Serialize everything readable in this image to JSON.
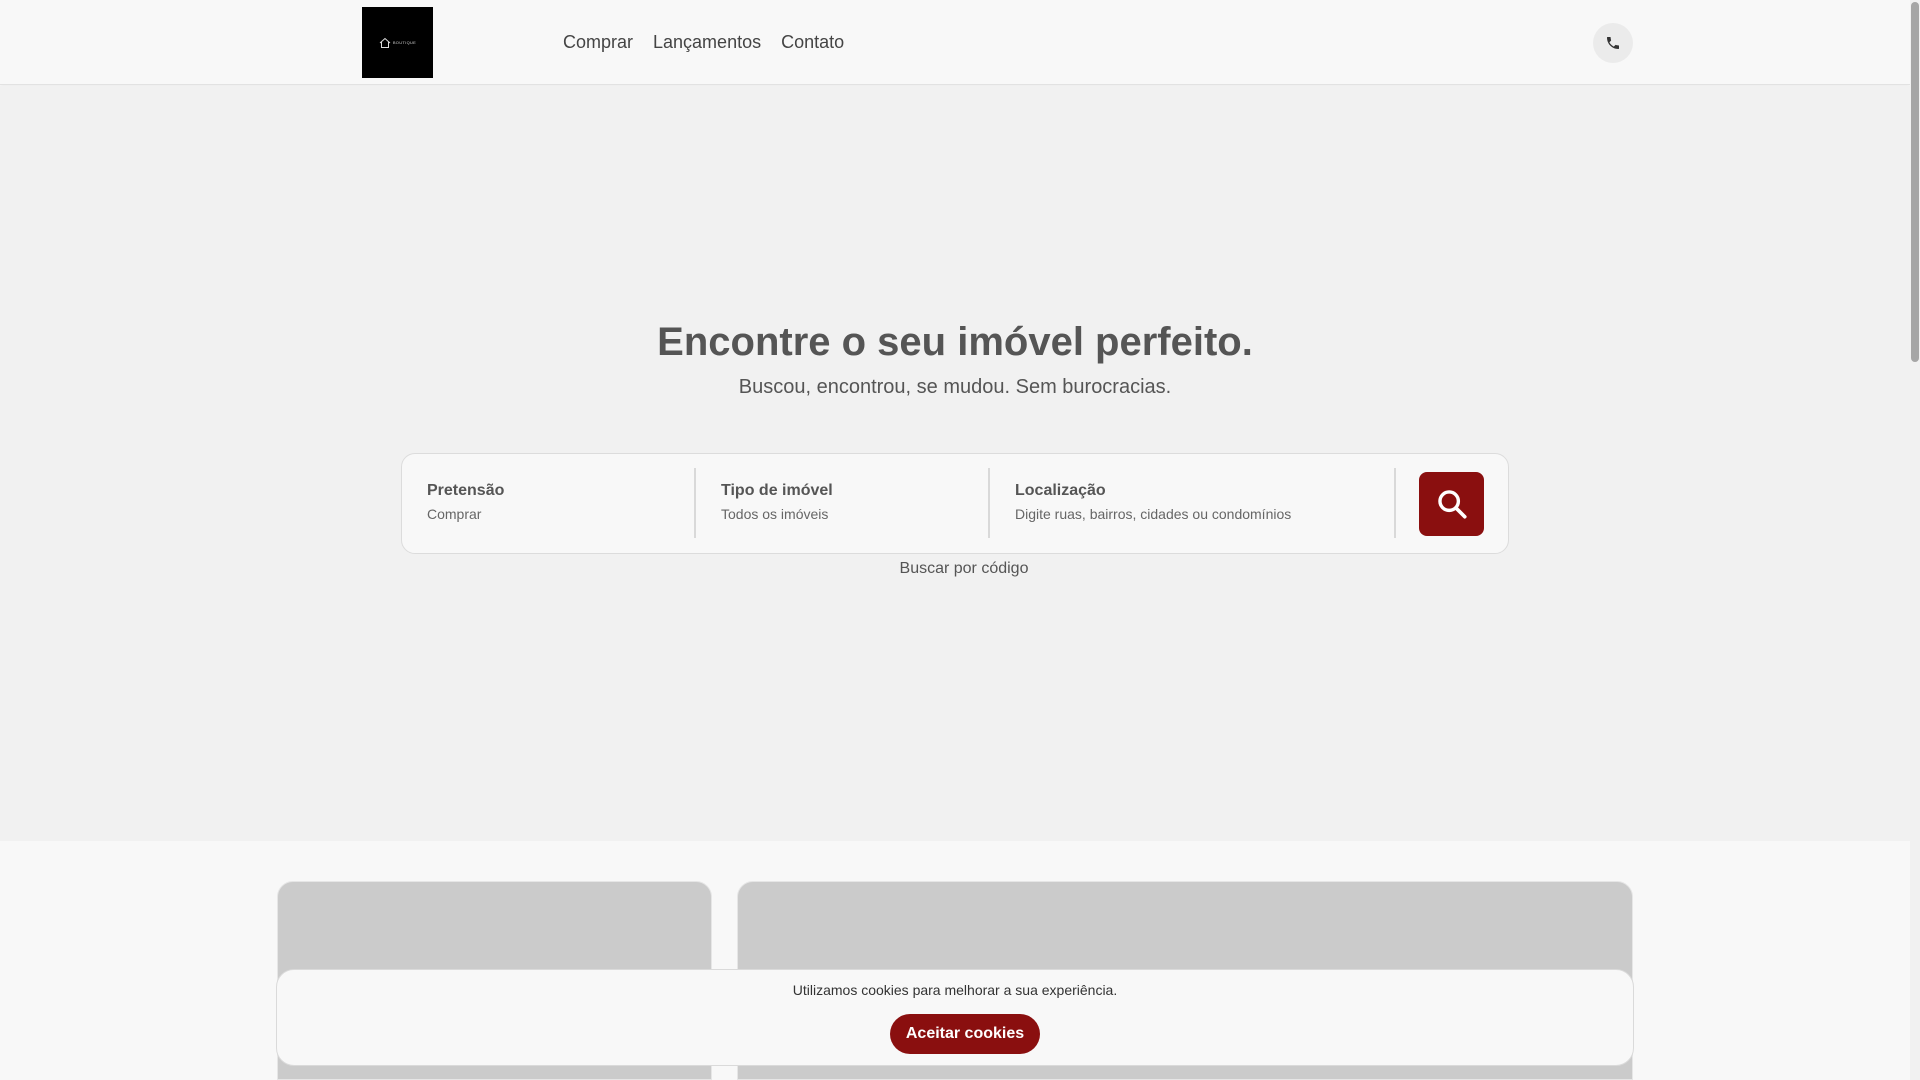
{
  "header": {
    "logo_text": "BOUTIQUE",
    "nav": [
      {
        "label": "Comprar"
      },
      {
        "label": "Lançamentos"
      },
      {
        "label": "Contato"
      }
    ],
    "phone_icon": "phone-icon"
  },
  "hero": {
    "title": "Encontre o seu imóvel perfeito.",
    "subtitle": "Buscou, encontrou, se mudou. Sem burocracias."
  },
  "search": {
    "pretensao_label": "Pretensão",
    "pretensao_value": "Comprar",
    "tipo_label": "Tipo de imóvel",
    "tipo_value": "Todos os imóveis",
    "local_label": "Localização",
    "local_placeholder": "Digite ruas, bairros, cidades ou condomínios",
    "search_icon": "search-icon",
    "code_link": "Buscar por código"
  },
  "cookie": {
    "message": "Utilizamos cookies para melhorar a sua experiência.",
    "accept_label": "Aceitar cookies"
  },
  "colors": {
    "accent": "#8a0f0f",
    "hero_bg": "#f1f1f1",
    "page_bg": "#f8f8f8"
  }
}
